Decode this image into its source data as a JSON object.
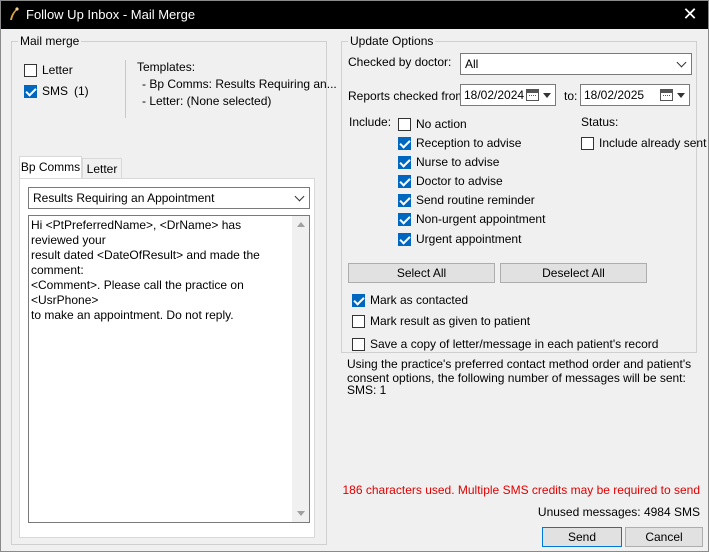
{
  "window": {
    "title": "Follow Up Inbox - Mail Merge",
    "close_glyph": "✕"
  },
  "mail_merge": {
    "legend": "Mail merge",
    "letter_label": "Letter",
    "letter_checked": false,
    "sms_label": "SMS",
    "sms_count": "(1)",
    "sms_checked": true,
    "templates_title": "Templates:",
    "template_lines": [
      "- Bp Comms: Results Requiring an...",
      "- Letter: (None selected)"
    ]
  },
  "tabs": [
    {
      "label": "Bp Comms",
      "active": true
    },
    {
      "label": "Letter",
      "active": false
    }
  ],
  "template_select": {
    "value": "Results Requiring an Appointment"
  },
  "message": {
    "body": "Hi <PtPreferredName>, <DrName> has reviewed your\nresult dated <DateOfResult> and made the comment:\n<Comment>. Please call the practice on <UsrPhone>\nto make an appointment. Do not reply."
  },
  "update_options": {
    "legend": "Update Options",
    "checked_by_label": "Checked by doctor:",
    "checked_by_value": "All",
    "reports_from_label": "Reports checked from:",
    "date_from": "18/02/2024",
    "to_label": "to:",
    "date_to": "18/02/2025",
    "include_label": "Include:",
    "status_label": "Status:",
    "include_items": [
      {
        "label": "No action",
        "checked": false
      },
      {
        "label": "Reception to advise",
        "checked": true
      },
      {
        "label": "Nurse to advise",
        "checked": true
      },
      {
        "label": "Doctor to advise",
        "checked": true
      },
      {
        "label": "Send routine reminder",
        "checked": true
      },
      {
        "label": "Non-urgent appointment",
        "checked": true
      },
      {
        "label": "Urgent appointment",
        "checked": true
      }
    ],
    "include_already_sent_label": "Include already sent",
    "include_already_sent_checked": false,
    "select_all": "Select All",
    "deselect_all": "Deselect All",
    "mark_contacted_label": "Mark as contacted",
    "mark_contacted_checked": true,
    "mark_given_label": "Mark result as given to patient",
    "mark_given_checked": false,
    "save_copy_label": "Save a copy of letter/message in each patient's record",
    "save_copy_checked": false
  },
  "info": {
    "lines": [
      "Using the practice's preferred contact method order and patient's",
      "consent options, the following number of messages will be sent:",
      "SMS: 1"
    ],
    "char_warning": "186 characters used. Multiple SMS credits may be required to send",
    "unused": "Unused messages: 4984 SMS"
  },
  "footer": {
    "send": "Send",
    "cancel": "Cancel"
  },
  "colors": {
    "accent": "#0067c0",
    "warning": "#e00000",
    "titlebar": "#000000"
  }
}
